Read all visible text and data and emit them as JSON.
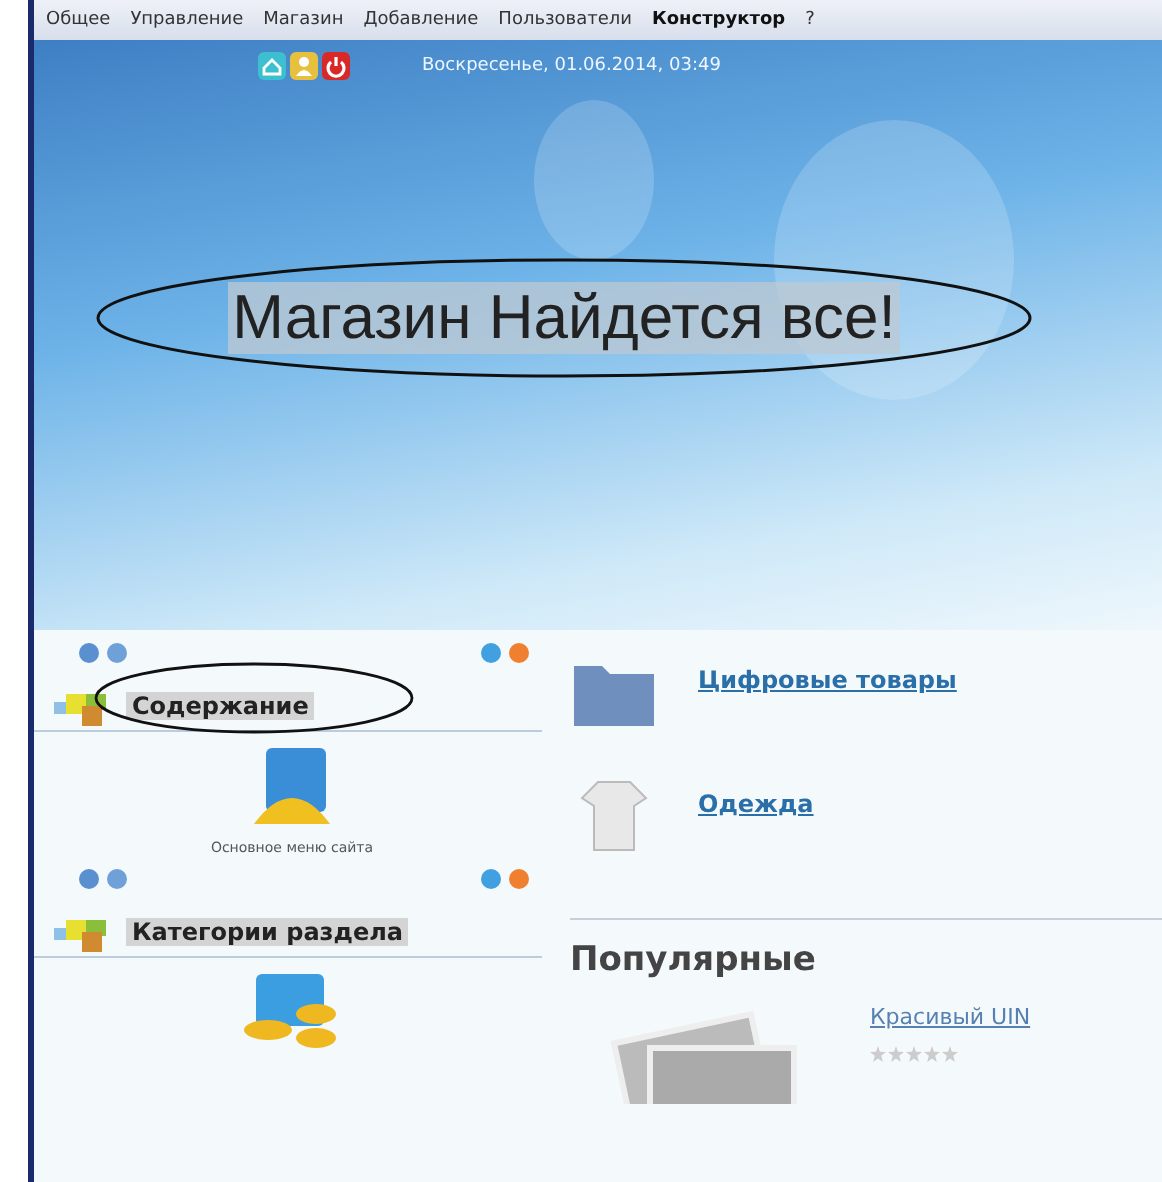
{
  "menu": [
    {
      "label": "Общее",
      "selected": false
    },
    {
      "label": "Управление",
      "selected": false
    },
    {
      "label": "Магазин",
      "selected": false
    },
    {
      "label": "Добавление",
      "selected": false
    },
    {
      "label": "Пользователи",
      "selected": false
    },
    {
      "label": "Конструктор",
      "selected": true
    },
    {
      "label": "?",
      "selected": false
    }
  ],
  "header": {
    "date": "Воскресенье, 01.06.2014, 03:49",
    "title": "Магазин Найдется все!"
  },
  "sidebar": [
    {
      "title": "Содержание",
      "circled": true,
      "item": "Основное меню сайта"
    },
    {
      "title": "Категории раздела",
      "circled": false
    }
  ],
  "categories": [
    {
      "label": "Цифровые товары",
      "kind": "folder"
    },
    {
      "label": "Одежда",
      "kind": "shirt"
    }
  ],
  "popular": {
    "title": "Популярные",
    "product": {
      "name": "Красивый UIN",
      "stars": 0
    }
  }
}
